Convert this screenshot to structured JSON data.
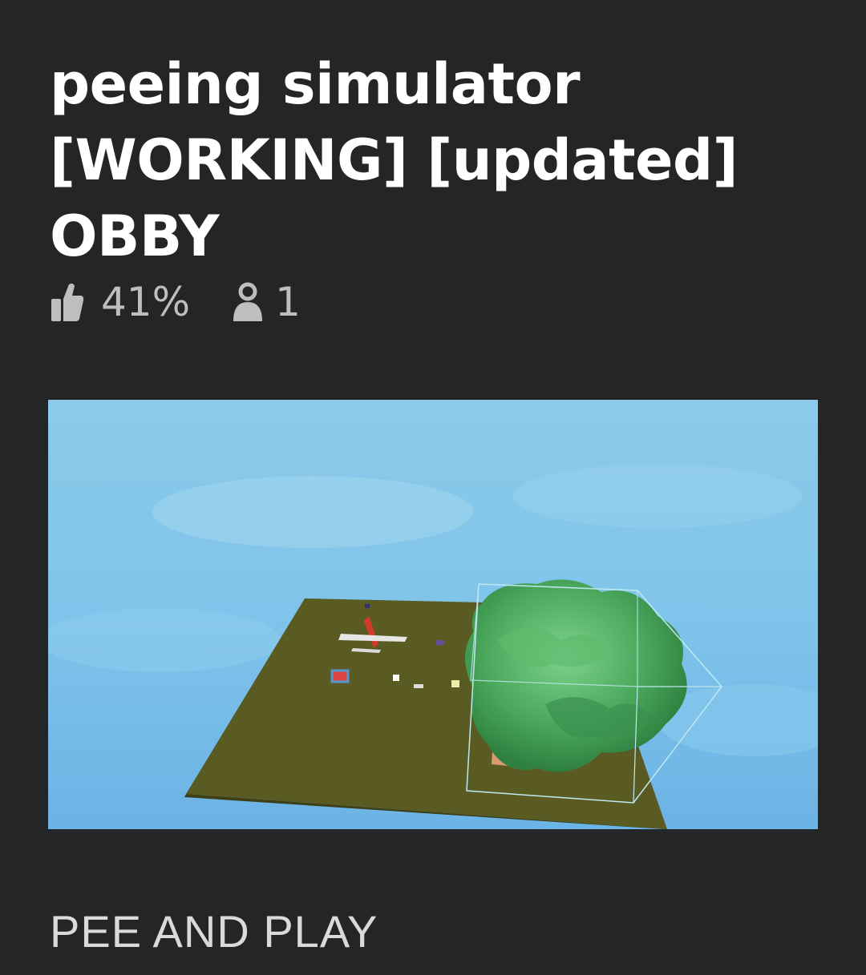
{
  "game": {
    "title": "peeing simulator [WORKING] [updated] OBBY",
    "rating": "41%",
    "players": "1",
    "description": "PEE AND PLAY"
  },
  "icons": {
    "rating": "thumbs-up-icon",
    "players": "person-icon"
  },
  "colors": {
    "background": "#232527",
    "title": "#ffffff",
    "stats": "#bdbebe",
    "description": "#d9dadb"
  }
}
